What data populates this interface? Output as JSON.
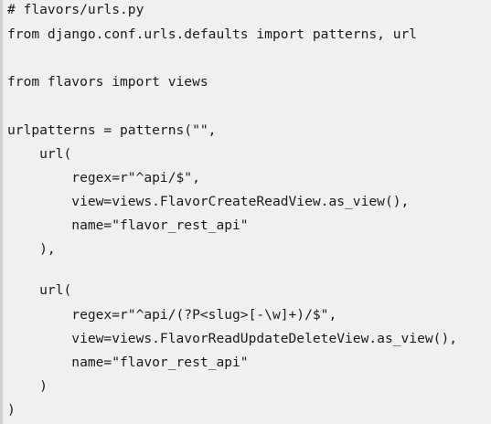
{
  "code": {
    "lines": [
      "# flavors/urls.py",
      "from django.conf.urls.defaults import patterns, url",
      "",
      "from flavors import views",
      "",
      "urlpatterns = patterns(\"\",",
      "    url(",
      "        regex=r\"^api/$\",",
      "        view=views.FlavorCreateReadView.as_view(),",
      "        name=\"flavor_rest_api\"",
      "    ),",
      "",
      "    url(",
      "        regex=r\"^api/(?P<slug>[-\\w]+)/$\",",
      "        view=views.FlavorReadUpdateDeleteView.as_view(),",
      "        name=\"flavor_rest_api\"",
      "    )",
      ")"
    ]
  }
}
